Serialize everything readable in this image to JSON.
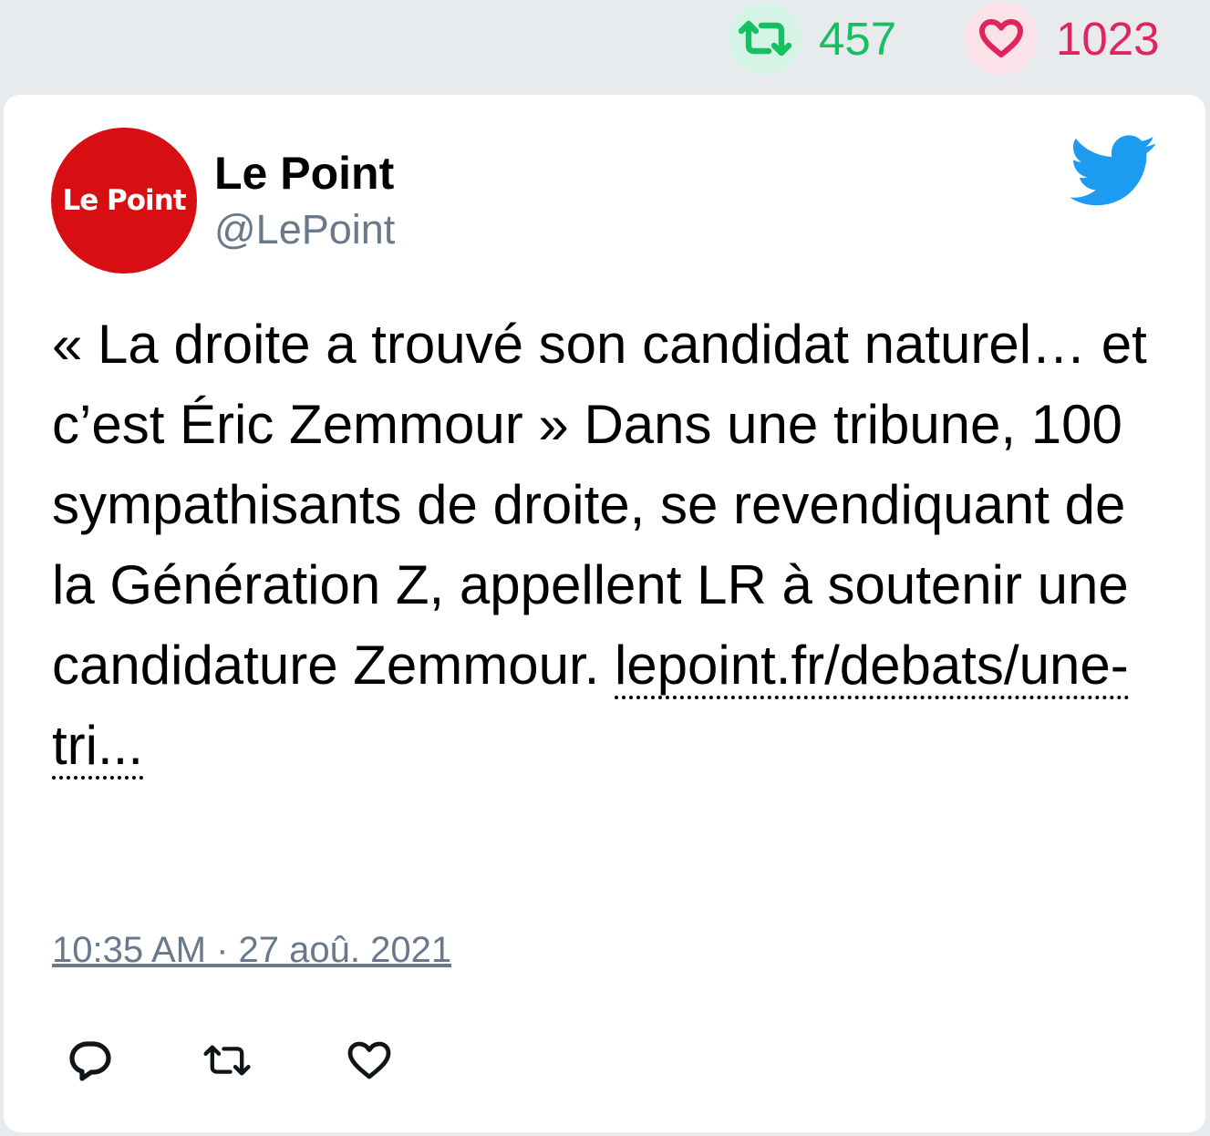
{
  "stats": {
    "retweet_count": "457",
    "like_count": "1023",
    "retweet_color": "#17bf63",
    "like_color": "#e0245e"
  },
  "tweet": {
    "author": {
      "name": "Le Point",
      "handle": "@LePoint",
      "avatar_text": "Le Point",
      "avatar_color": "#d80f12"
    },
    "text": "« La droite a trouvé son candidat naturel… et c’est Éric Zemmour » Dans une tribune, 100 sympathisants de droite, se revendiquant de la Génération Z, appellent LR à soutenir une candidature Zemmour. ",
    "link_text": "lepoint.fr/debats/une-tri...",
    "timestamp": "10:35 AM · 27 aoû. 2021",
    "brand_icon": "twitter-bird-icon",
    "brand_color": "#1d9bf0"
  },
  "actions": [
    {
      "name": "reply",
      "icon": "reply-icon"
    },
    {
      "name": "retweet",
      "icon": "retweet-icon"
    },
    {
      "name": "like",
      "icon": "heart-icon"
    }
  ]
}
